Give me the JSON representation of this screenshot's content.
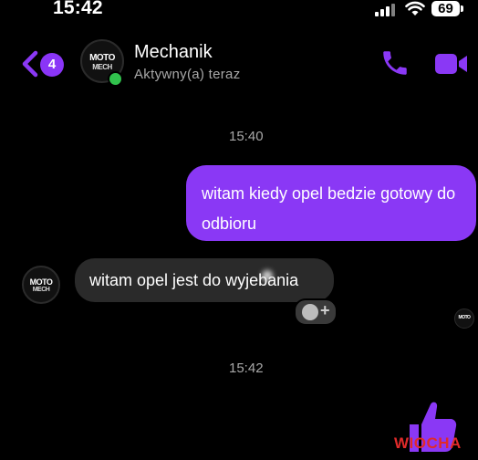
{
  "status_bar": {
    "time": "15:42",
    "battery": "69"
  },
  "header": {
    "back_badge_count": "4",
    "contact_name": "Mechanik",
    "contact_status": "Aktywny(a) teraz",
    "avatar_logo": {
      "line1": "MOTO",
      "line2": "MECH"
    }
  },
  "conversation": {
    "timestamp_1": "15:40",
    "outgoing_message": "witam kiedy opel bedzie gotowy do odbioru",
    "incoming_message": "witam opel jest do wyjebania",
    "timestamp_2": "15:42",
    "reaction_plus": "+"
  },
  "watermark": "WIOCHA",
  "colors": {
    "background": "#000000",
    "accent": "#8a38f5",
    "incoming_bubble": "#2a2a2a",
    "online": "#31c24d",
    "muted_text": "#a8a8a8"
  },
  "icons": [
    "back-chevron-icon",
    "phone-icon",
    "video-camera-icon",
    "emoji-react-icon",
    "thumbs-up-icon",
    "signal-icon",
    "wifi-icon",
    "battery-icon"
  ]
}
